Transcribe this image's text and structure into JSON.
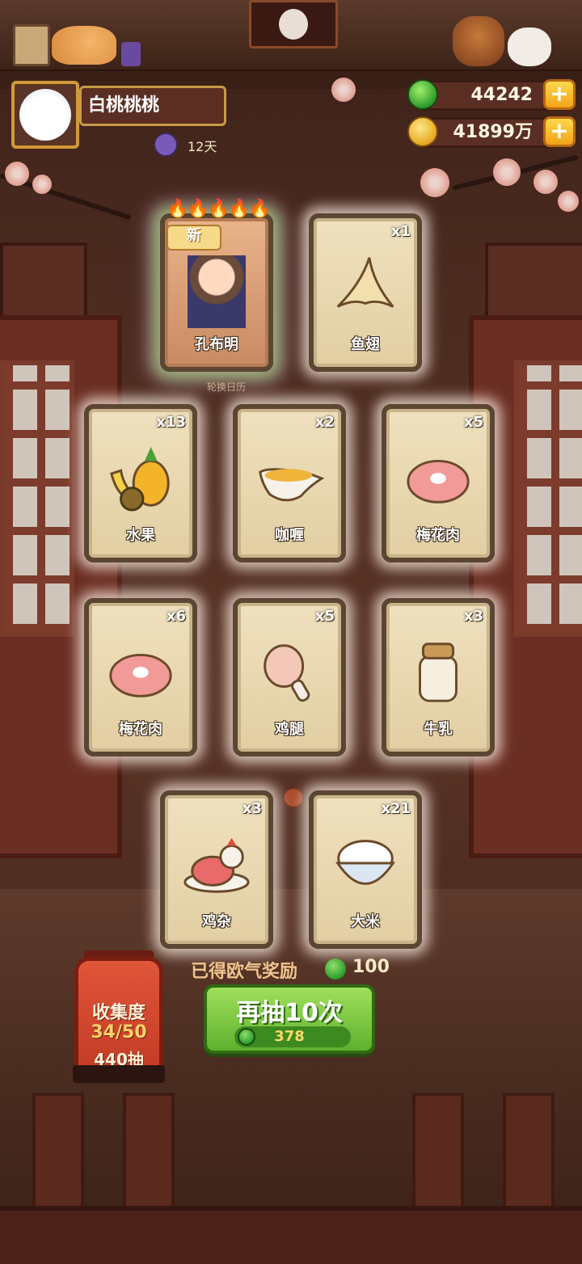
{
  "player": {
    "name": "白桃桃桃",
    "days": "12天"
  },
  "currency": {
    "jade": "44242",
    "coins": "41899万"
  },
  "featured_cards": [
    {
      "name": "孔布明",
      "count": "",
      "is_new": true,
      "new_label": "新",
      "stars": 5
    },
    {
      "name": "鱼翅",
      "count": "x1"
    }
  ],
  "calendar_hint": "轮换日历",
  "cards": [
    {
      "name": "水果",
      "count": "x13",
      "icon": "fruit-icon"
    },
    {
      "name": "咖喱",
      "count": "x2",
      "icon": "curry-icon"
    },
    {
      "name": "梅花肉",
      "count": "x5",
      "icon": "pork-icon"
    },
    {
      "name": "梅花肉",
      "count": "x6",
      "icon": "pork-icon"
    },
    {
      "name": "鸡腿",
      "count": "x5",
      "icon": "drumstick-icon"
    },
    {
      "name": "牛乳",
      "count": "x3",
      "icon": "milk-jar-icon"
    },
    {
      "name": "鸡杂",
      "count": "x3",
      "icon": "chicken-dish-icon"
    },
    {
      "name": "大米",
      "count": "x21",
      "icon": "rice-bowl-icon"
    }
  ],
  "reward": {
    "label": "已得欧气奖励",
    "value": "100"
  },
  "draw_button": {
    "label": "再抽10次",
    "cost": "378"
  },
  "collection": {
    "title": "收集度",
    "progress": "34/50",
    "draws": "440抽"
  },
  "colors": {
    "accent_green": "#5eb02e",
    "gold": "#d29a36",
    "card_bg": "#efe1bf"
  }
}
